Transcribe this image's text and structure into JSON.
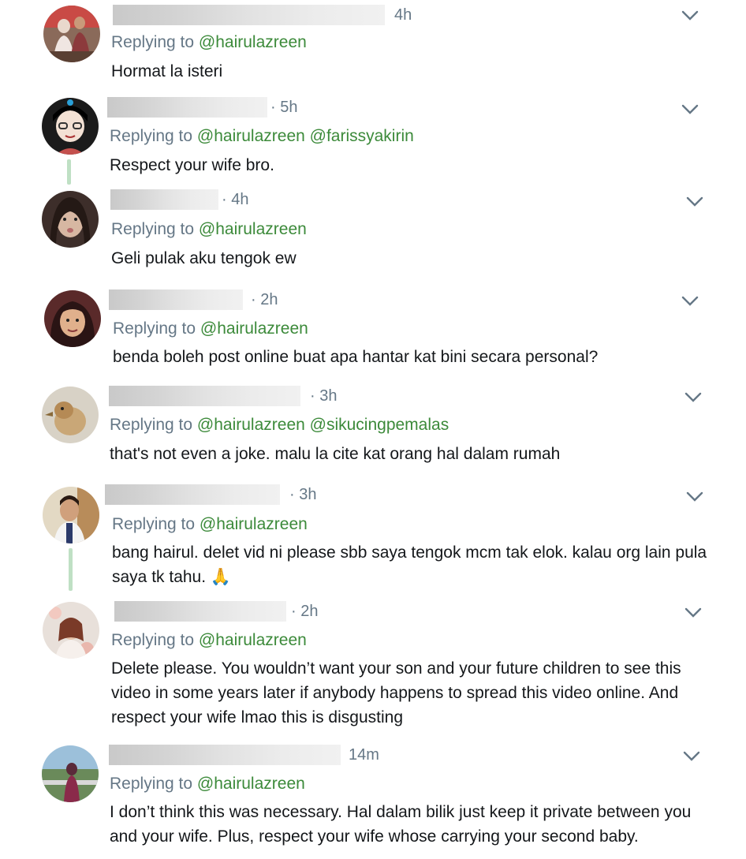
{
  "replying_prefix": "Replying to",
  "replies": [
    {
      "time": "4h",
      "mentions": [
        "@hairulazreen"
      ],
      "lines": [
        "Hormat la isteri"
      ],
      "avatar": "avatar-photo-couple"
    },
    {
      "time": "· 5h",
      "mentions": [
        "@hairulazreen",
        "@farissyakirin"
      ],
      "lines": [
        "Respect your wife bro."
      ],
      "avatar": "avatar-cartoon-girl"
    },
    {
      "time": "· 4h",
      "mentions": [
        "@hairulazreen"
      ],
      "lines": [
        "Geli pulak aku tengok ew"
      ],
      "avatar": "avatar-photo-woman"
    },
    {
      "time": "· 2h",
      "mentions": [
        "@hairulazreen"
      ],
      "lines": [
        "benda boleh post online buat apa hantar kat bini secara personal?"
      ],
      "avatar": "avatar-photo-hijab"
    },
    {
      "time": "· 3h",
      "mentions": [
        "@hairulazreen",
        "@sikucingpemalas"
      ],
      "lines": [
        "that's not even a joke. malu la cite kat orang hal dalam rumah"
      ],
      "avatar": "avatar-photo-duck"
    },
    {
      "time": "· 3h",
      "mentions": [
        "@hairulazreen"
      ],
      "lines": [
        "bang hairul. delet vid ni please sbb saya tengok mcm tak elok. kalau org lain pula",
        "saya tk tahu. 🙏"
      ],
      "avatar": "avatar-photo-man"
    },
    {
      "time": "· 2h",
      "mentions": [
        "@hairulazreen"
      ],
      "lines": [
        "Delete please. You wouldn’t want your son and your future children to see this",
        "video in some years later if anybody happens to spread this video online. And",
        "respect your wife lmao this is disgusting"
      ],
      "avatar": "avatar-photo-flowers"
    },
    {
      "time": "14m",
      "mentions": [
        "@hairulazreen"
      ],
      "lines": [
        "I don’t think this was necessary. Hal dalam bilik just keep it private between you",
        "and your wife. Plus, respect your wife whose carrying your second baby."
      ],
      "avatar": "avatar-photo-outdoor"
    }
  ]
}
